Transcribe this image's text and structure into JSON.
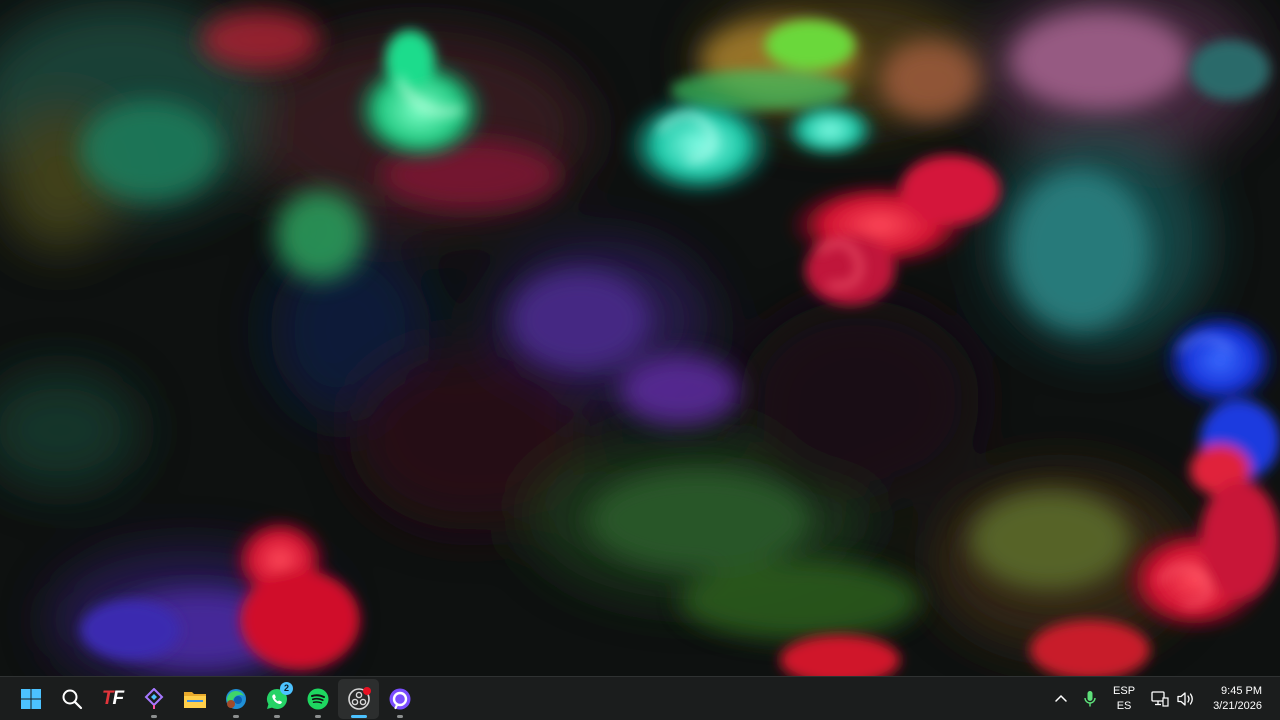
{
  "desktop": {
    "wallpaper": "fluid-ink-abstract"
  },
  "taskbar": {
    "pinned": [
      {
        "name": "start-button",
        "icon": "windows-logo-icon"
      },
      {
        "name": "search-button",
        "icon": "search-icon"
      },
      {
        "name": "tf-app-button",
        "icon": "tf-logo-icon",
        "logo_t": "T",
        "logo_f": "F"
      },
      {
        "name": "app-launcher-button",
        "icon": "diamond-arrows-icon"
      },
      {
        "name": "file-explorer-button",
        "icon": "folder-icon"
      },
      {
        "name": "edge-browser-button",
        "icon": "edge-icon"
      },
      {
        "name": "whatsapp-button",
        "icon": "whatsapp-icon",
        "badge": "2"
      },
      {
        "name": "spotify-button",
        "icon": "spotify-icon"
      },
      {
        "name": "obs-button",
        "icon": "obs-record-icon",
        "active": true
      },
      {
        "name": "alexa-button",
        "icon": "alexa-ring-icon"
      }
    ],
    "tray": {
      "overflow_icon": "chevron-up-icon",
      "mic_icon": "microphone-icon",
      "language_top": "ESP",
      "language_bottom": "ES",
      "network_icon": "network-icon",
      "volume_icon": "speaker-icon",
      "time": "9:45 PM",
      "date": "3/21/2026"
    },
    "colors": {
      "accent": "#4cc2ff",
      "taskbar_bg": "#1c1e1e"
    }
  }
}
